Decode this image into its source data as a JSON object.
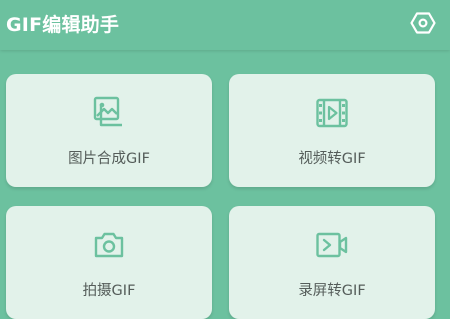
{
  "app": {
    "title": "GIF编辑助手"
  },
  "toolbar": {
    "settings_icon": "settings-hexagon-icon"
  },
  "cards": [
    {
      "label": "图片合成GIF",
      "icon": "image-stack-icon"
    },
    {
      "label": "视频转GIF",
      "icon": "film-strip-icon"
    },
    {
      "label": "拍摄GIF",
      "icon": "camera-icon"
    },
    {
      "label": "录屏转GIF",
      "icon": "screen-record-icon"
    }
  ],
  "colors": {
    "primary": "#6cc19f",
    "card_background": "#e2f2ea",
    "icon_color": "#6cc19f",
    "label_color": "#555d5a",
    "title_color": "#ffffff"
  }
}
